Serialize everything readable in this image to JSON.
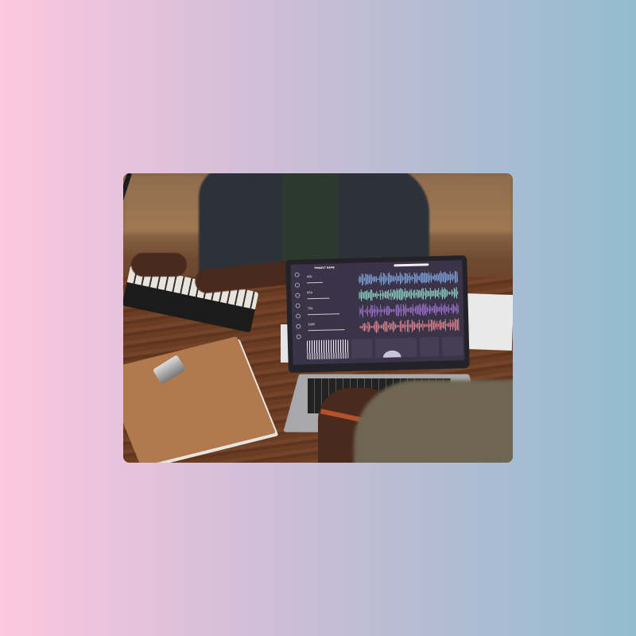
{
  "scene": {
    "background_gradient": [
      "#fcc7e0",
      "#93bccf"
    ]
  },
  "screen": {
    "project_title": "PROJECT NAME",
    "controls": [
      {
        "value": "450"
      },
      {
        "value": "850"
      },
      {
        "value": "750"
      },
      {
        "value": "1005"
      }
    ],
    "wave_colors": [
      "#7fa6e0",
      "#8ed3c4",
      "#9d72cf",
      "#e2838f"
    ]
  }
}
